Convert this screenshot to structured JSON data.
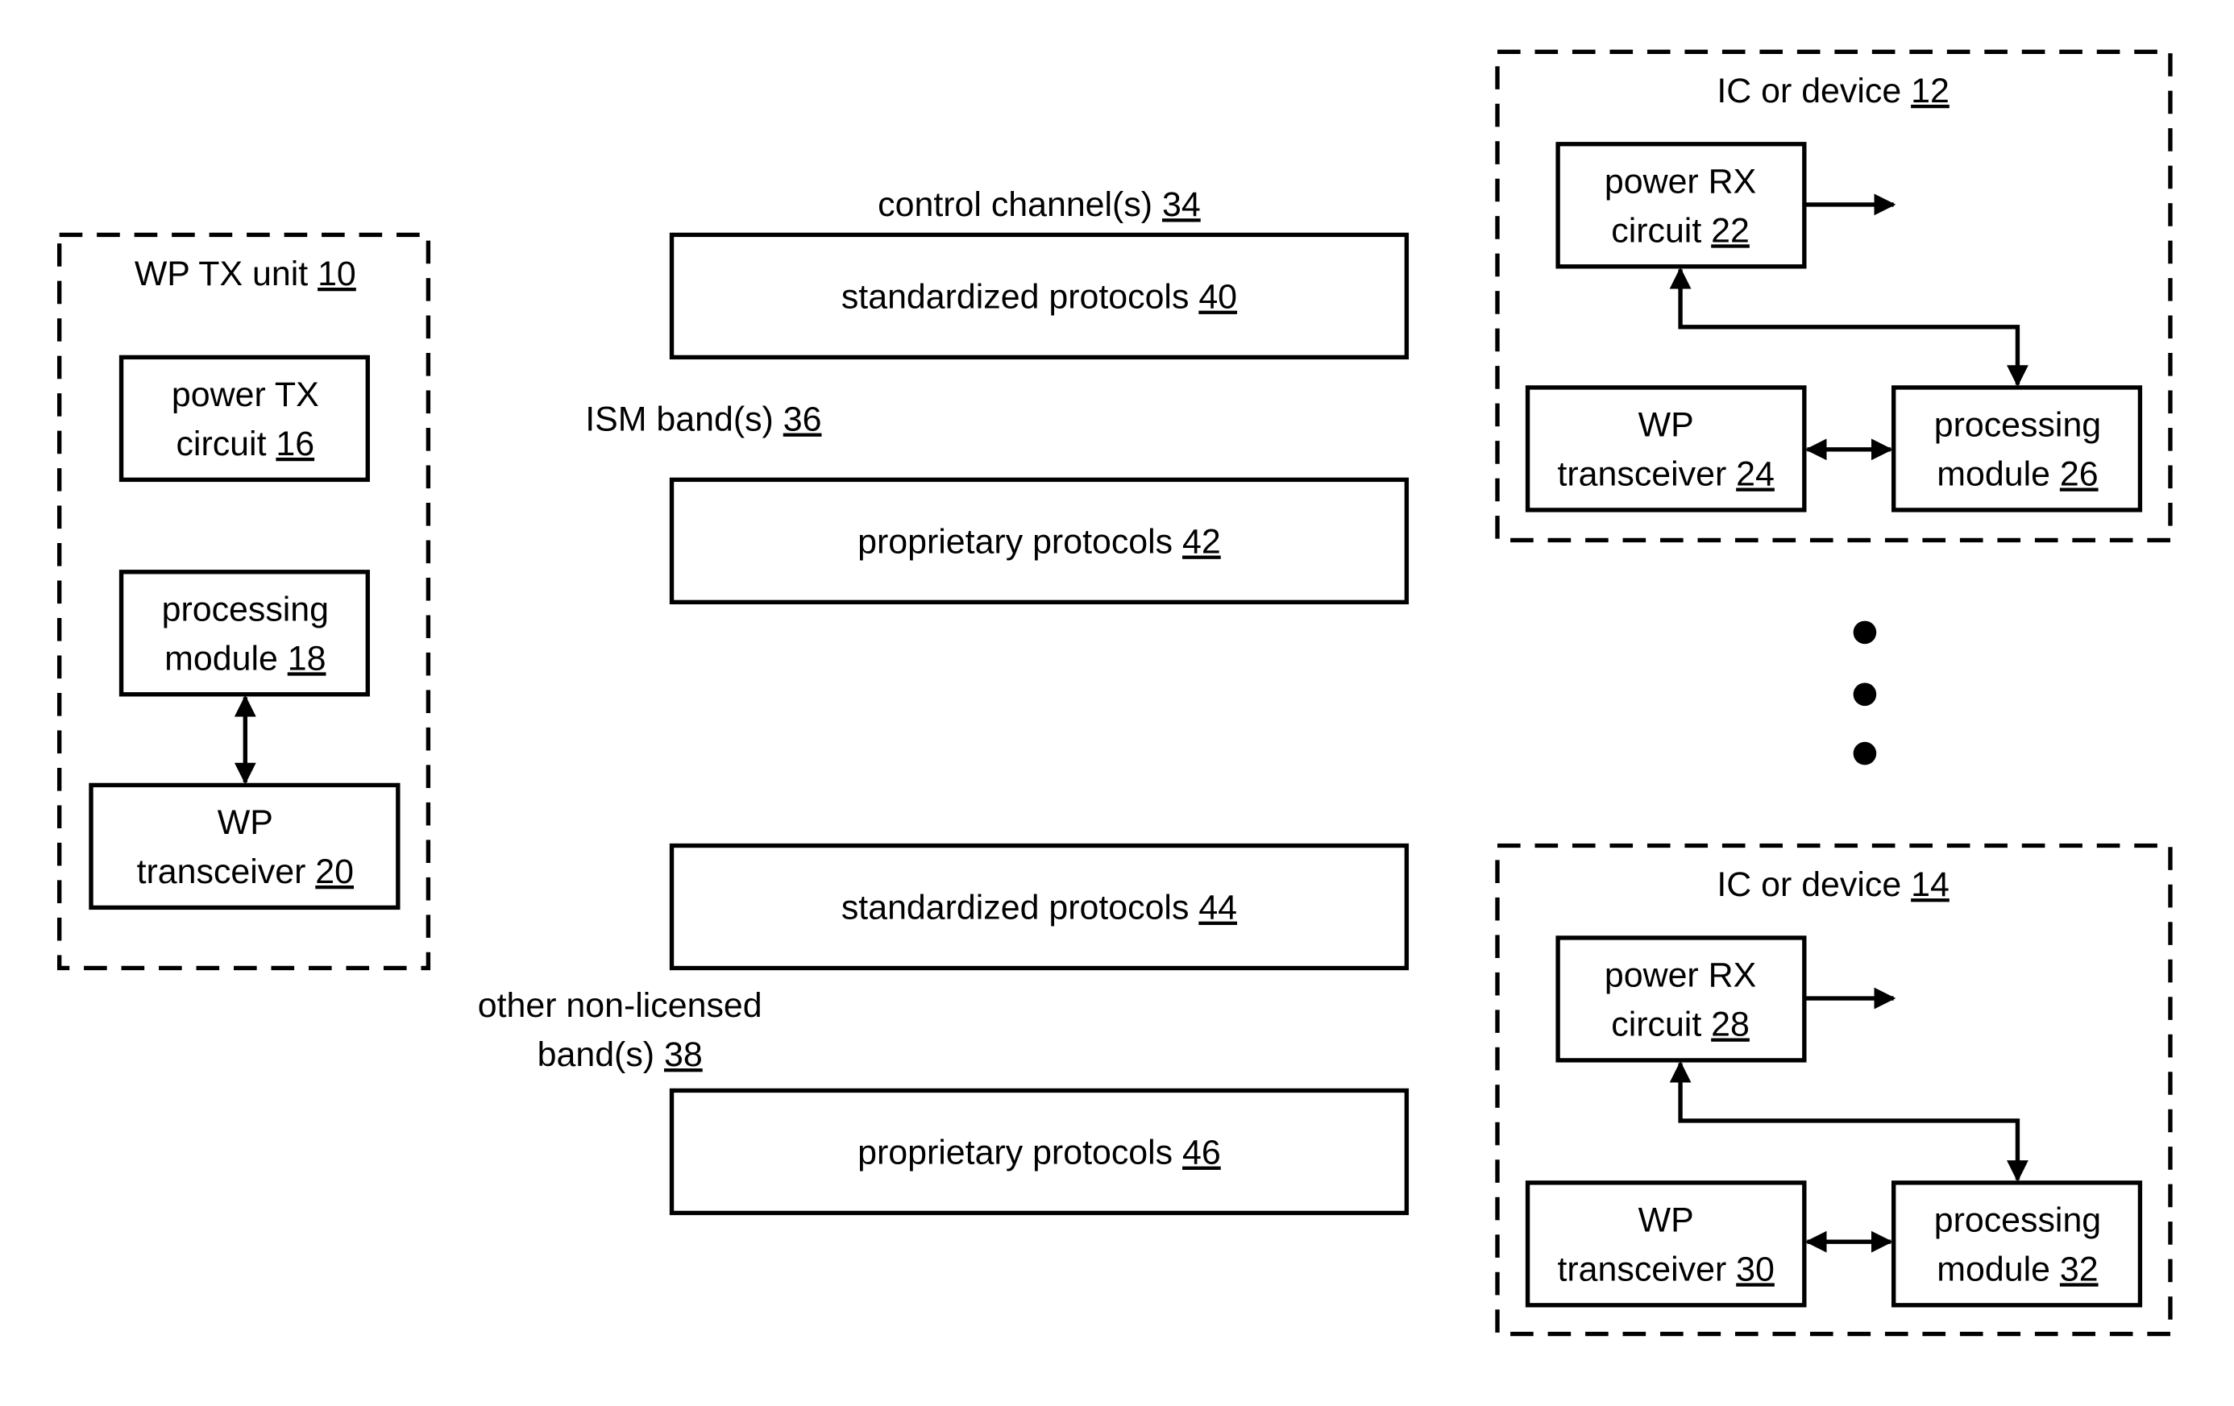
{
  "figure": {
    "tx_unit": {
      "title": "WP TX unit ",
      "ref": "10",
      "power_tx": {
        "line1": "power TX",
        "line2": "circuit ",
        "ref": "16"
      },
      "processing": {
        "line1": "processing",
        "line2": "module ",
        "ref": "18"
      },
      "transceiver": {
        "line1": "WP",
        "line2": "transceiver ",
        "ref": "20"
      }
    },
    "channels": {
      "control": {
        "label": "control channel(s) ",
        "ref": "34"
      },
      "ism": {
        "label": "ISM band(s) ",
        "ref": "36"
      },
      "other": {
        "line1": "other non-licensed",
        "line2": "band(s) ",
        "ref": "38"
      },
      "std1": {
        "label": "standardized protocols ",
        "ref": "40"
      },
      "prop1": {
        "label": "proprietary protocols ",
        "ref": "42"
      },
      "std2": {
        "label": "standardized protocols ",
        "ref": "44"
      },
      "prop2": {
        "label": "proprietary protocols ",
        "ref": "46"
      }
    },
    "device1": {
      "title": "IC or device ",
      "ref": "12",
      "power_rx": {
        "line1": "power RX",
        "line2": "circuit ",
        "ref": "22"
      },
      "transceiver": {
        "line1": "WP",
        "line2": "transceiver ",
        "ref": "24"
      },
      "processing": {
        "line1": "processing",
        "line2": "module ",
        "ref": "26"
      }
    },
    "device2": {
      "title": "IC or device ",
      "ref": "14",
      "power_rx": {
        "line1": "power RX",
        "line2": "circuit ",
        "ref": "28"
      },
      "transceiver": {
        "line1": "WP",
        "line2": "transceiver ",
        "ref": "30"
      },
      "processing": {
        "line1": "processing",
        "line2": "module ",
        "ref": "32"
      }
    },
    "ellipsis": "vertical-ellipsis"
  }
}
